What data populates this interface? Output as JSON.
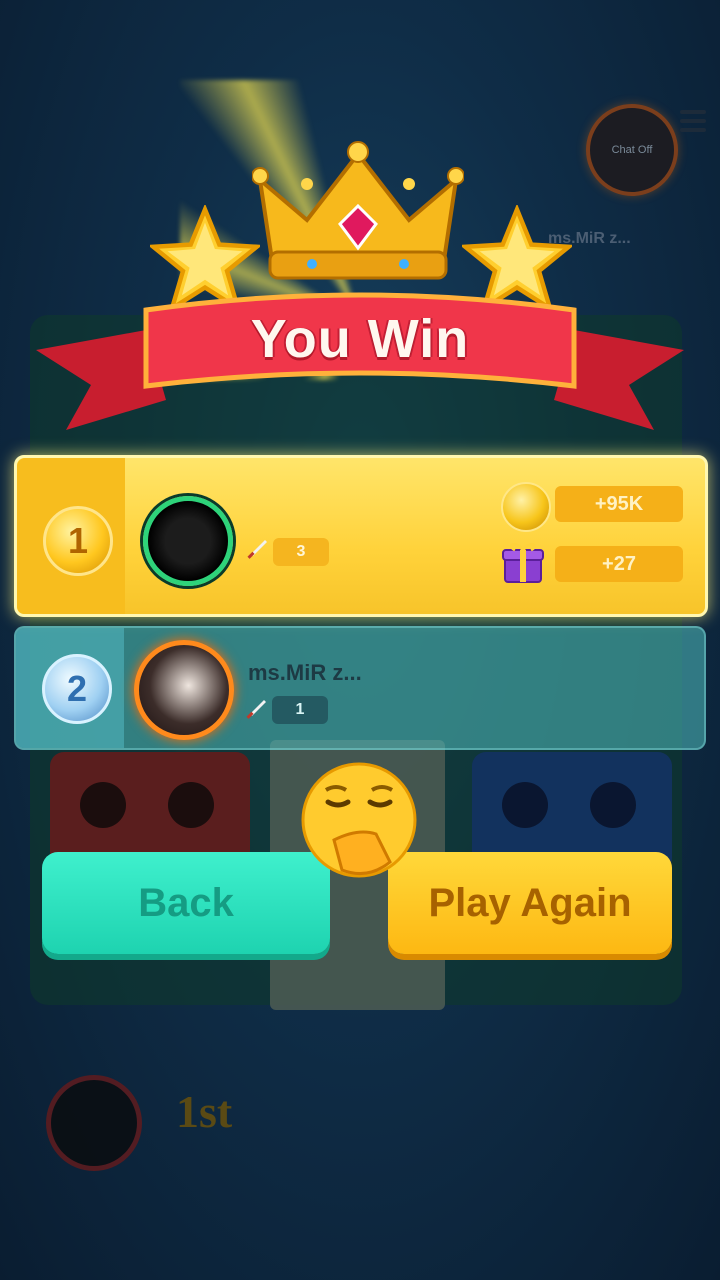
{
  "header": {
    "title": "You Win",
    "chat_label": "Chat Off",
    "opponent_tag": "ms.MiR z..."
  },
  "results": [
    {
      "rank": "1",
      "name": "",
      "kills": "3",
      "coins": "+95K",
      "gifts": "+27",
      "highlight_color": "#ffd23a"
    },
    {
      "rank": "2",
      "name": "ms.MiR z...",
      "kills": "1",
      "highlight_color": "#4fc0c0"
    }
  ],
  "buttons": {
    "back_label": "Back",
    "play_again_label": "Play Again"
  },
  "footer": {
    "place_label": "1st"
  },
  "icons": {
    "crown": "crown-icon",
    "stars": "star-icon",
    "coin": "coin-icon",
    "gift": "gift-icon",
    "sword": "sword-icon",
    "emoji": "yawning-face-emoji"
  }
}
